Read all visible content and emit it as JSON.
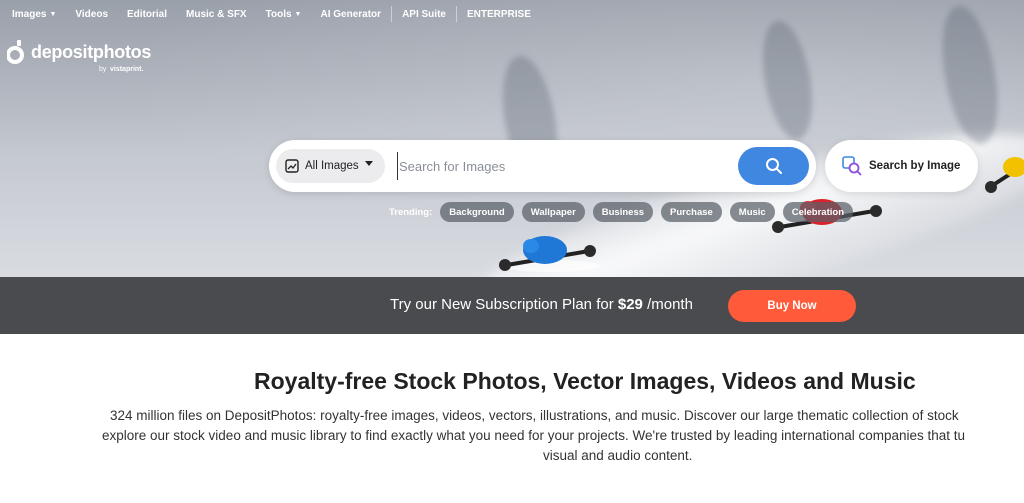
{
  "nav": {
    "items": [
      {
        "label": "Images",
        "dropdown": true
      },
      {
        "label": "Videos",
        "dropdown": false
      },
      {
        "label": "Editorial",
        "dropdown": false
      },
      {
        "label": "Music & SFX",
        "dropdown": false
      },
      {
        "label": "Tools",
        "dropdown": true
      },
      {
        "label": "AI Generator",
        "dropdown": false
      },
      {
        "label": "API Suite",
        "dropdown": false
      },
      {
        "label": "ENTERPRISE",
        "dropdown": false
      }
    ]
  },
  "logo": {
    "word": "depositphotos",
    "by": "by",
    "partner": "vistaprint."
  },
  "search": {
    "type_label": "All Images",
    "placeholder": "Search for Images",
    "value": "",
    "button_icon": "search-icon",
    "by_image_label": "Search by Image"
  },
  "trending": {
    "label": "Trending:",
    "chips": [
      "Background",
      "Wallpaper",
      "Business",
      "Purchase",
      "Music",
      "Celebration"
    ]
  },
  "promo": {
    "text_before": "Try our New Subscription Plan for ",
    "price": "$29",
    "text_after": " /month",
    "button_label": "Buy Now",
    "button_color": "#ff5a3a"
  },
  "content": {
    "title": "Royalty-free Stock Photos, Vector Images, Videos and Music",
    "desc_lines": [
      "324 million files on DepositPhotos: royalty-free images, videos, vectors, illustrations, and music. Discover our large thematic collection of stock",
      "explore our stock video and music library to find exactly what you need for your projects. We're trusted by leading international companies that tu",
      "visual and audio content."
    ]
  },
  "colors": {
    "accent": "#3f87e0",
    "promo_bg": "#4a4b4f",
    "cta": "#ff5a3a"
  }
}
